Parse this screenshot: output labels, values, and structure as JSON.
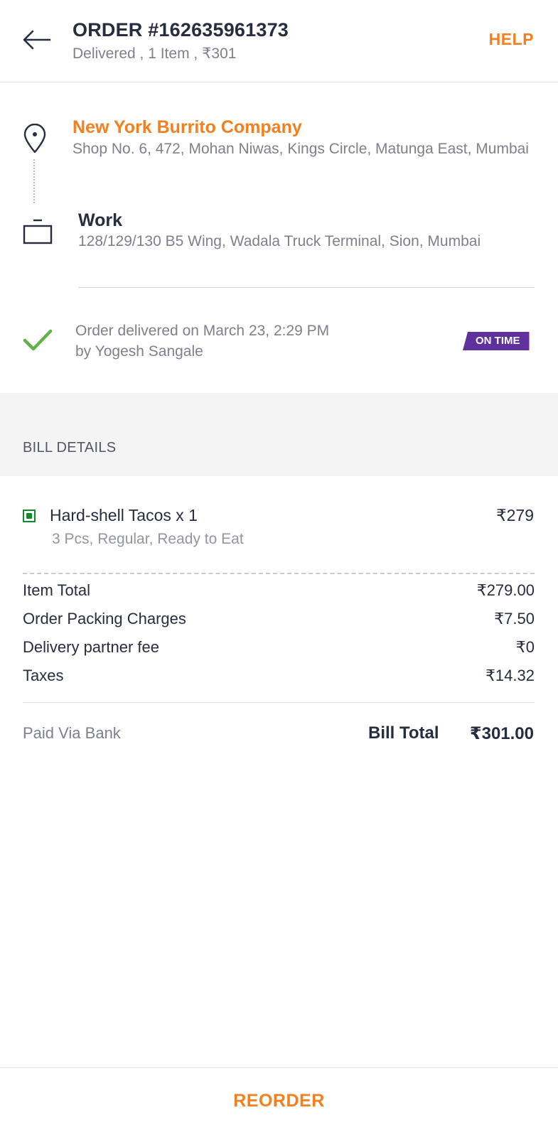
{
  "header": {
    "title": "ORDER #162635961373",
    "subtitle": "Delivered , 1 Item , ₹301",
    "help_label": "HELP"
  },
  "restaurant": {
    "name": "New York Burrito Company",
    "address": "Shop No. 6, 472, Mohan Niwas, Kings Circle, Matunga East, Mumbai"
  },
  "destination": {
    "label": "Work",
    "address": "128/129/130 B5 Wing, Wadala Truck Terminal, Sion, Mumbai"
  },
  "delivery": {
    "line1": "Order delivered on March 23, 2:29 PM",
    "line2": "by Yogesh Sangale",
    "badge": "ON TIME"
  },
  "bill": {
    "heading": "BILL DETAILS",
    "items": [
      {
        "name": "Hard-shell Tacos x 1",
        "description": "3 Pcs, Regular, Ready to Eat",
        "price": "₹279"
      }
    ],
    "charges": [
      {
        "label": "Item Total",
        "value": "₹279.00"
      },
      {
        "label": "Order Packing Charges",
        "value": "₹7.50"
      },
      {
        "label": "Delivery partner fee",
        "value": "₹0"
      },
      {
        "label": "Taxes",
        "value": "₹14.32"
      }
    ],
    "paid_via": "Paid Via Bank",
    "total_label": "Bill Total",
    "total_value": "₹301.00"
  },
  "footer": {
    "reorder_label": "REORDER"
  },
  "icons": {
    "back": "arrow-left-icon",
    "restaurant": "map-pin-icon",
    "destination": "briefcase-icon",
    "delivered": "check-icon",
    "veg": "veg-indicator-icon"
  },
  "colors": {
    "accent": "#f37f1f",
    "badge": "#60319c",
    "success": "#60b246",
    "veg": "#0f8a2b"
  }
}
